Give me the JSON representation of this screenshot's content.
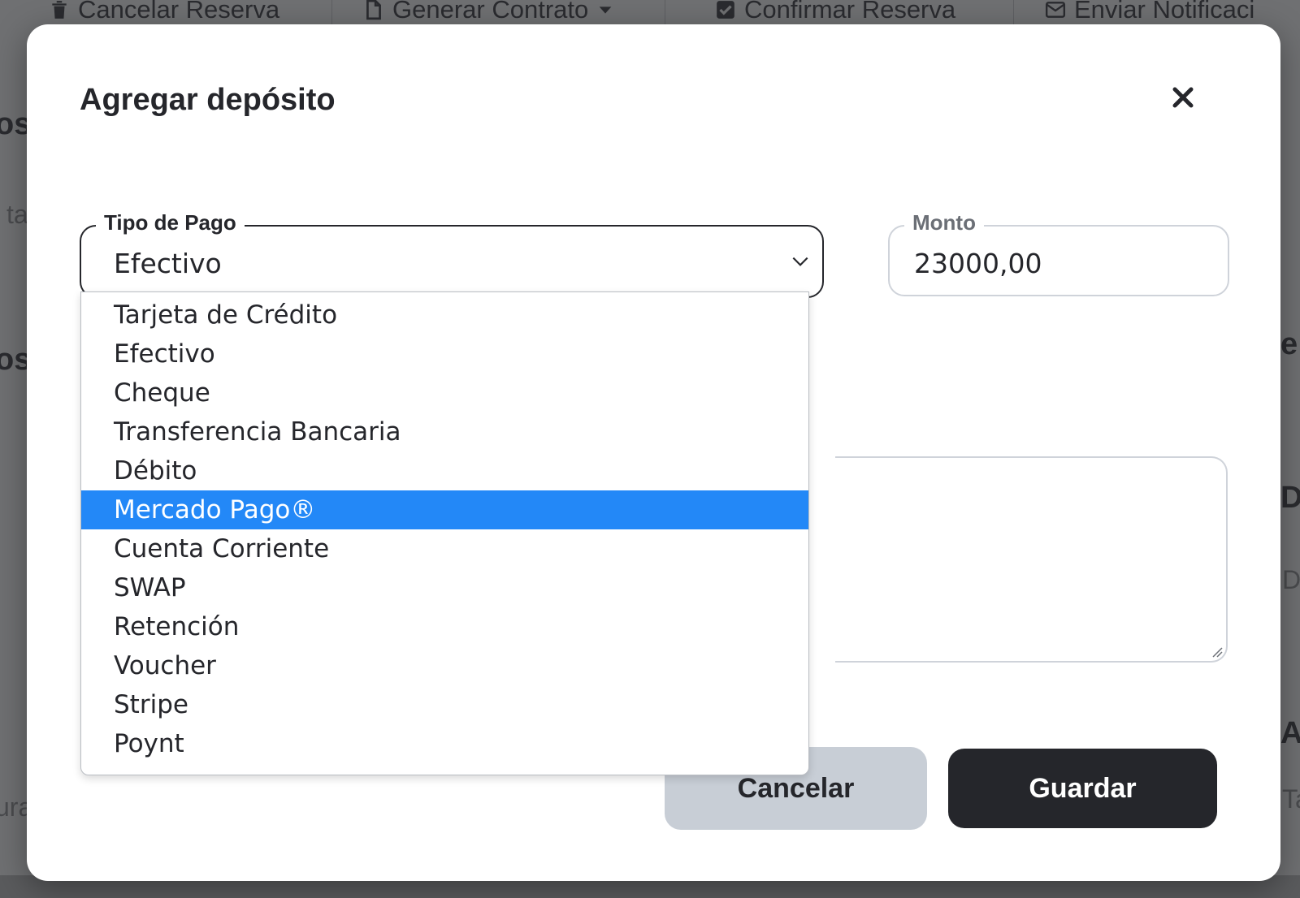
{
  "background": {
    "toolbar": [
      {
        "label": "Cancelar Reserva",
        "icon": "trash-icon"
      },
      {
        "label": "Generar Contrato",
        "icon": "document-icon"
      },
      {
        "label": "Confirmar Reserva",
        "icon": "check-square-icon"
      },
      {
        "label": "Enviar Notificaci",
        "icon": "envelope-icon"
      }
    ],
    "fragments": [
      "os",
      "ta",
      "os",
      "e",
      "D",
      "Di",
      "A",
      "Ta",
      "ura"
    ]
  },
  "modal": {
    "title": "Agregar depósito",
    "close_icon": "close-icon",
    "payment_type": {
      "label": "Tipo de Pago",
      "value": "Efectivo",
      "options": [
        "Tarjeta de Crédito",
        "Efectivo",
        "Cheque",
        "Transferencia Bancaria",
        "Débito",
        "Mercado Pago®",
        "Cuenta Corriente",
        "SWAP",
        "Retención",
        "Voucher",
        "Stripe",
        "Poynt"
      ],
      "highlighted_option": "Mercado Pago®"
    },
    "amount": {
      "label": "Monto",
      "value": "23000,00"
    },
    "buttons": {
      "cancel": "Cancelar",
      "save": "Guardar"
    }
  },
  "colors": {
    "highlight": "#2388f7",
    "primary_button": "#25262b",
    "secondary_button": "#c8ced6"
  }
}
